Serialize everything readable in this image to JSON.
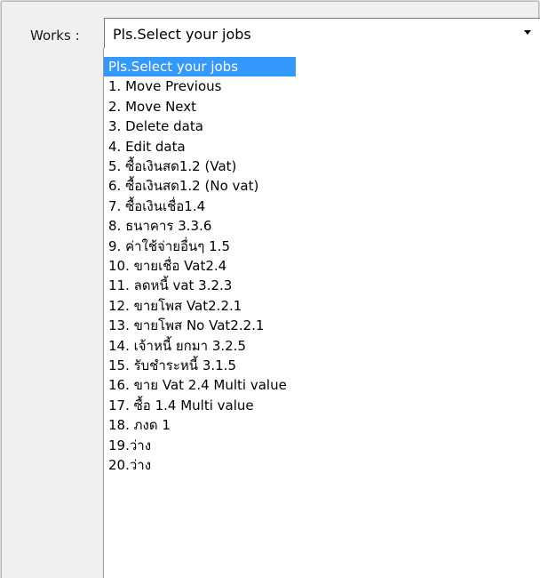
{
  "form": {
    "label": "Works :",
    "combo": {
      "selected_value": "Pls.Select your jobs",
      "arrow_icon": "chevron-down-icon"
    }
  },
  "dropdown": {
    "highlight_color": "#3399ff",
    "options": [
      "Pls.Select your jobs",
      "1. Move Previous",
      "2. Move Next",
      "3. Delete data",
      "4. Edit data",
      "5. ซื้อเงินสด1.2 (Vat)",
      "6. ซื้อเงินสด1.2 (No vat)",
      "7. ซื้อเงินเชื่อ1.4",
      "8. ธนาคาร 3.3.6",
      "9. ค่าใช้จ่ายอื่นๆ 1.5",
      "10. ขายเชื่อ Vat2.4",
      "11. ลดหนี้ vat 3.2.3",
      "12. ขายโพส Vat2.2.1",
      "13. ขายโพส No Vat2.2.1",
      "14. เจ้าหนี้ ยกมา 3.2.5",
      "15. รับชำระหนี้ 3.1.5",
      "16. ขาย Vat 2.4 Multi value",
      "17. ซื้อ 1.4 Multi value",
      "18. ภงด 1",
      "19.ว่าง",
      "20.ว่าง"
    ]
  }
}
